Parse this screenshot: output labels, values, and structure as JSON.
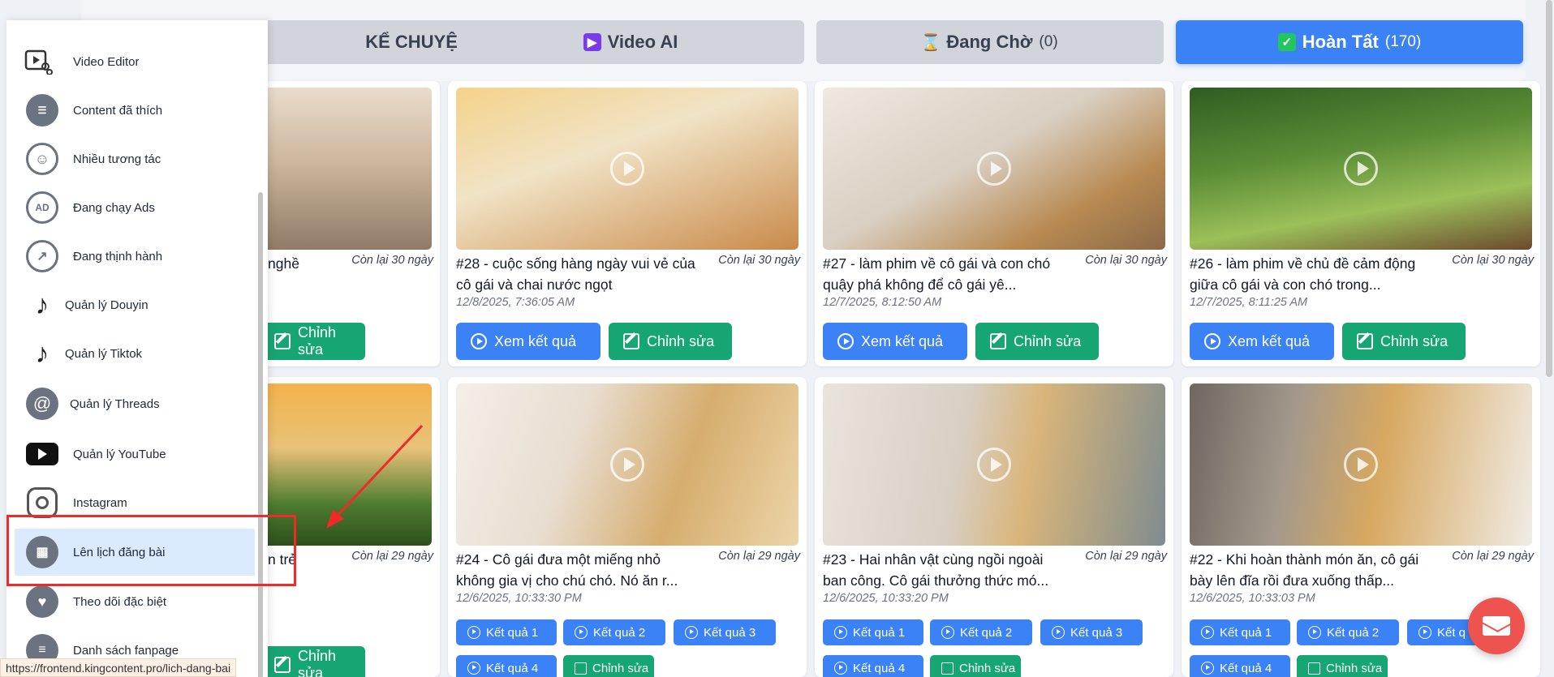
{
  "tabs": [
    {
      "label": "KỂ CHUYỆN",
      "count": "",
      "icon": "story-icon"
    },
    {
      "label": "Video AI",
      "count": "",
      "icon": "clapper-icon"
    },
    {
      "label": "Đang Chờ",
      "count": "(0)",
      "icon": "hourglass-icon"
    },
    {
      "label": "Hoàn Tất",
      "count": "(170)",
      "icon": "check-icon"
    }
  ],
  "cards": [
    {
      "title": "nghề",
      "remain": "Còn lại 30 ngày",
      "date": "",
      "edit": "Chỉnh sửa"
    },
    {
      "title": "#28 - cuộc sống hàng ngày vui vẻ của cô gái và chai nước ngọt",
      "remain": "Còn lại 30 ngày",
      "date": "12/8/2025, 7:36:05 AM",
      "view": "Xem kết quả",
      "edit": "Chỉnh sửa"
    },
    {
      "title": "#27 - làm phim về cô gái và con chó quậy phá không để cô gái yê...",
      "remain": "Còn lại 30 ngày",
      "date": "12/7/2025, 8:12:50 AM",
      "view": "Xem kết quả",
      "edit": "Chỉnh sửa"
    },
    {
      "title": "#26 - làm phim về chủ đề cảm động giữa cô gái và con chó trong...",
      "remain": "Còn lại 30 ngày",
      "date": "12/7/2025, 8:11:25 AM",
      "view": "Xem kết quả",
      "edit": "Chỉnh sửa"
    },
    {
      "title": "n trẻ",
      "remain": "Còn lại 29 ngày",
      "date": "",
      "edit": "Chỉnh sửa"
    },
    {
      "title": "#24 - Cô gái đưa một miếng nhỏ không gia vị cho chú chó. Nó ăn r...",
      "remain": "Còn lại 29 ngày",
      "date": "12/6/2025, 10:33:30 PM",
      "results": [
        "Kết quả 1",
        "Kết quả 2",
        "Kết quả 3",
        "Kết quả 4"
      ],
      "edit": "Chỉnh sửa"
    },
    {
      "title": "#23 - Hai nhân vật cùng ngồi ngoài ban công. Cô gái thưởng thức mó...",
      "remain": "Còn lại 29 ngày",
      "date": "12/6/2025, 10:33:20 PM",
      "results": [
        "Kết quả 1",
        "Kết quả 2",
        "Kết quả 3",
        "Kết quả 4"
      ],
      "edit": "Chỉnh sửa"
    },
    {
      "title": "#22 - Khi hoàn thành món ăn, cô gái bày lên đĩa rồi đưa xuống thấp...",
      "remain": "Còn lại 29 ngày",
      "date": "12/6/2025, 10:33:03 PM",
      "results": [
        "Kết quả 1",
        "Kết quả 2",
        "Kết q",
        "Kết quả 4"
      ],
      "edit": "Chỉnh sửa"
    }
  ],
  "sidebar": {
    "items": [
      {
        "label": "Video Editor",
        "icon": "video-editor-icon"
      },
      {
        "label": "Content đã thích",
        "icon": "liked-content-icon"
      },
      {
        "label": "Nhiều tương tác",
        "icon": "smile-icon"
      },
      {
        "label": "Đang chạy Ads",
        "icon": "ads-icon",
        "glyph": "AD"
      },
      {
        "label": "Đang thịnh hành",
        "icon": "trending-icon"
      },
      {
        "label": "Quản lý Douyin",
        "icon": "douyin-icon"
      },
      {
        "label": "Quản lý Tiktok",
        "icon": "tiktok-icon"
      },
      {
        "label": "Quản lý Threads",
        "icon": "threads-icon",
        "glyph": "@"
      },
      {
        "label": "Quản lý YouTube",
        "icon": "youtube-icon"
      },
      {
        "label": "Instagram",
        "icon": "instagram-icon"
      },
      {
        "label": "Lên lịch đăng bài",
        "icon": "calendar-icon"
      },
      {
        "label": "Theo dõi đặc biệt",
        "icon": "heart-icon"
      },
      {
        "label": "Danh sách fanpage",
        "icon": "fanpage-list-icon"
      }
    ]
  },
  "status_url": "https://frontend.kingcontent.pro/lich-dang-bai",
  "colors": {
    "primary": "#3b82f6",
    "success": "#16a673",
    "highlight": "#ef2a2a",
    "fab": "#ef5350"
  }
}
